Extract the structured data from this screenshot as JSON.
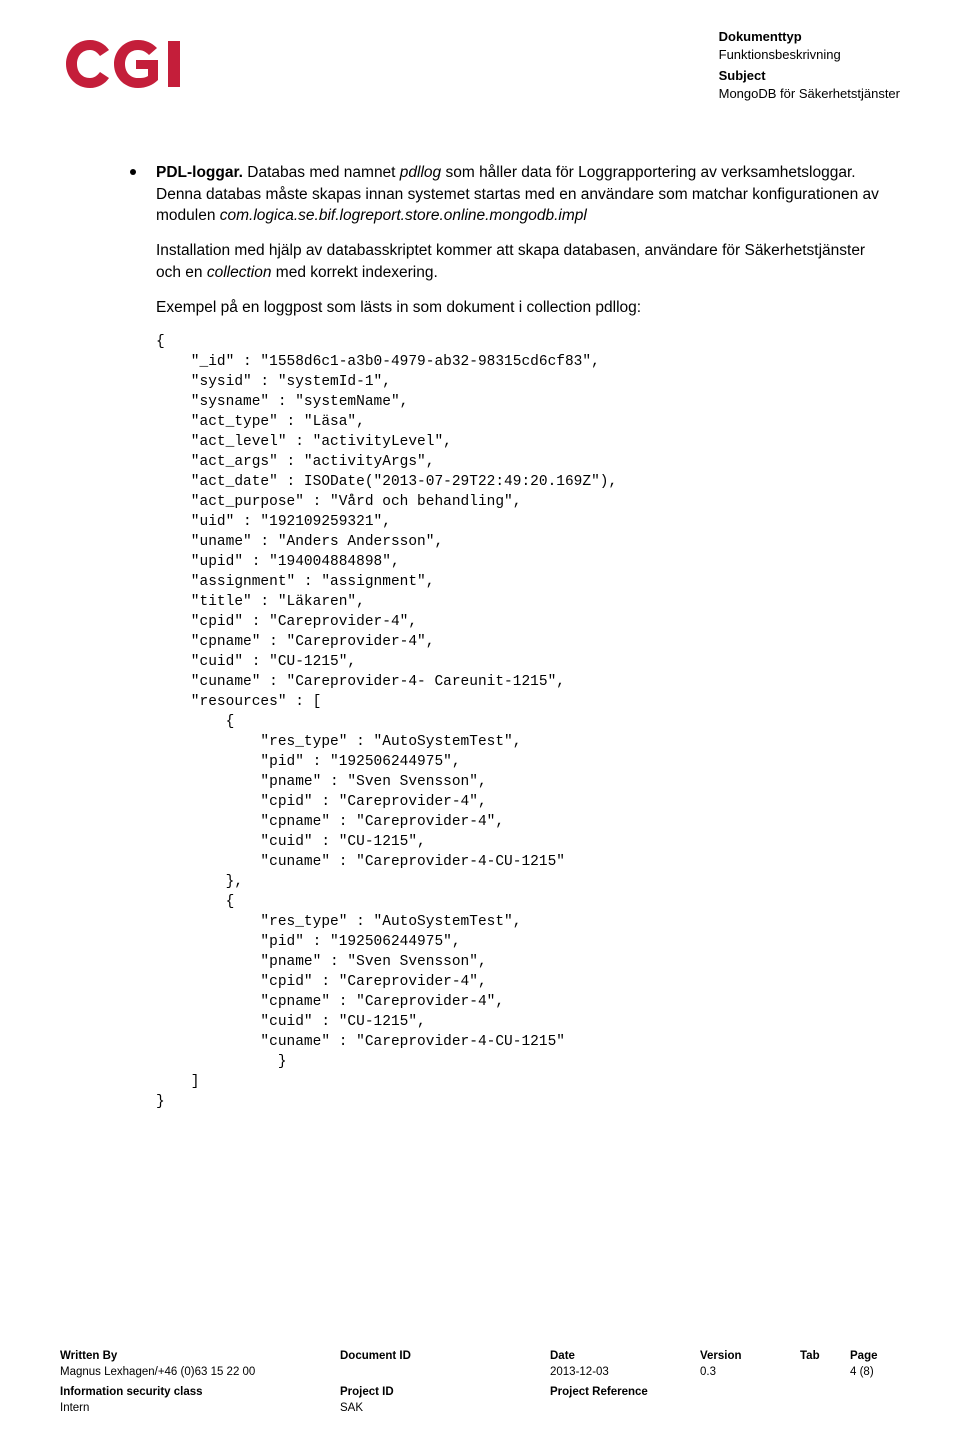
{
  "header": {
    "logo_text": "CGI",
    "meta": {
      "dokumenttyp_label": "Dokumenttyp",
      "dokumenttyp_value": "Funktionsbeskrivning",
      "subject_label": "Subject",
      "subject_value": "MongoDB för Säkerhetstjänster"
    }
  },
  "content": {
    "bullet": {
      "bold_prefix": "PDL-loggar.",
      "text_after_prefix": " Databas med namnet ",
      "italic1": "pdllog",
      "text_mid": " som håller data för Loggrapportering av verksamhetsloggar. Denna databas måste skapas innan systemet startas med en användare som matchar konfigurationen av modulen ",
      "italic2": "com.logica.se.bif.logreport.store.online.mongodb.impl"
    },
    "para1_a": "Installation med hjälp av databasskriptet kommer att skapa databasen, användare för Säkerhetstjänster och en ",
    "para1_italic": "collection",
    "para1_b": " med korrekt indexering.",
    "para2": "Exempel på en loggpost som lästs in som dokument i collection pdllog:",
    "code": "{\n    \"_id\" : \"1558d6c1-a3b0-4979-ab32-98315cd6cf83\",\n    \"sysid\" : \"systemId-1\",\n    \"sysname\" : \"systemName\",\n    \"act_type\" : \"Läsa\",\n    \"act_level\" : \"activityLevel\",\n    \"act_args\" : \"activityArgs\",\n    \"act_date\" : ISODate(\"2013-07-29T22:49:20.169Z\"),\n    \"act_purpose\" : \"Vård och behandling\",\n    \"uid\" : \"192109259321\",\n    \"uname\" : \"Anders Andersson\",\n    \"upid\" : \"194004884898\",\n    \"assignment\" : \"assignment\",\n    \"title\" : \"Läkaren\",\n    \"cpid\" : \"Careprovider-4\",\n    \"cpname\" : \"Careprovider-4\",\n    \"cuid\" : \"CU-1215\",\n    \"cuname\" : \"Careprovider-4- Careunit-1215\",\n    \"resources\" : [\n        {\n            \"res_type\" : \"AutoSystemTest\",\n            \"pid\" : \"192506244975\",\n            \"pname\" : \"Sven Svensson\",\n            \"cpid\" : \"Careprovider-4\",\n            \"cpname\" : \"Careprovider-4\",\n            \"cuid\" : \"CU-1215\",\n            \"cuname\" : \"Careprovider-4-CU-1215\"\n        },\n        {\n            \"res_type\" : \"AutoSystemTest\",\n            \"pid\" : \"192506244975\",\n            \"pname\" : \"Sven Svensson\",\n            \"cpid\" : \"Careprovider-4\",\n            \"cpname\" : \"Careprovider-4\",\n            \"cuid\" : \"CU-1215\",\n            \"cuname\" : \"Careprovider-4-CU-1215\"\n              }\n    ]\n}"
  },
  "footer": {
    "row1": {
      "c1_label": "Written By",
      "c2_label": "Document ID",
      "c3_label": "Date",
      "c4_label": "Version",
      "c5_label": "Tab",
      "c6_label": "Page"
    },
    "row2": {
      "c1": "Magnus Lexhagen/+46 (0)63 15 22 00",
      "c2": "",
      "c3": "2013-12-03",
      "c4": "0.3",
      "c5": "",
      "c6": "4 (8)"
    },
    "row3": {
      "c1_label": "Information security class",
      "c2_label": "Project ID",
      "c3_label": "Project Reference"
    },
    "row4": {
      "c1": "Intern",
      "c2": "SAK",
      "c3": ""
    }
  }
}
